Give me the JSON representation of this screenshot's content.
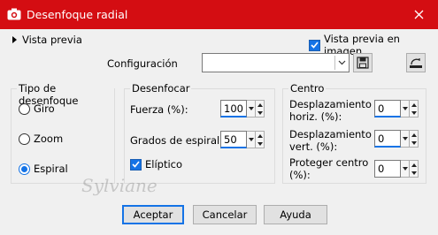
{
  "titlebar": {
    "title": "Desenfoque radial",
    "app_icon": "camera-icon",
    "close_icon": "close-icon"
  },
  "preview": {
    "toggle_label": "Vista previa",
    "in_image_label": "Vista previa en imagen",
    "in_image_checked": true
  },
  "config": {
    "label": "Configuración",
    "value": "",
    "save_icon": "save-icon",
    "reset_icon": "reset-icon"
  },
  "blur_type": {
    "legend": "Tipo de desenfoque",
    "options": [
      {
        "label": "Giro",
        "selected": false
      },
      {
        "label": "Zoom",
        "selected": false
      },
      {
        "label": "Espiral",
        "selected": true
      }
    ]
  },
  "blur": {
    "legend": "Desenfocar",
    "strength_label": "Fuerza (%):",
    "strength_value": "100",
    "spiral_label": "Grados de espiral:",
    "spiral_value": "50",
    "elliptic_label": "Elíptico",
    "elliptic_checked": true
  },
  "center": {
    "legend": "Centro",
    "h_label_1": "Desplazamiento",
    "h_label_2": "horiz. (%):",
    "h_value": "0",
    "v_label_1": "Desplazamiento",
    "v_label_2": "vert. (%):",
    "v_value": "0",
    "protect_label_1": "Proteger centro",
    "protect_label_2": "(%):",
    "protect_value": "0"
  },
  "buttons": {
    "ok": "Aceptar",
    "cancel": "Cancelar",
    "help": "Ayuda"
  },
  "watermark": "Sylviane",
  "colors": {
    "titlebar": "#d40d12",
    "accent": "#1473e6"
  }
}
